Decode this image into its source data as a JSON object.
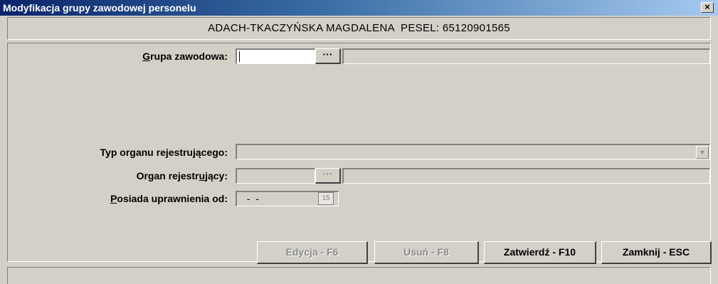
{
  "window": {
    "title": "Modyfikacja grupy zawodowej personelu",
    "close_label": "×"
  },
  "header": {
    "person": "ADACH-TKACZYŃSKA MAGDALENA  PESEL: 65120901565"
  },
  "form": {
    "grupa_zawodowa": {
      "label_accel": "G",
      "label_rest": "rupa zawodowa:",
      "value": "",
      "browse_label": "···",
      "description": ""
    },
    "typ_organu": {
      "label": "Typ organu rejestrującego:",
      "value": "",
      "dropdown_icon": "chevron-down-icon"
    },
    "organ_rejestrujacy": {
      "label_pre": "Organ rejestr",
      "label_accel": "u",
      "label_post": "jący:",
      "value": "",
      "browse_label": "···",
      "description": ""
    },
    "posiada_uprawnienia": {
      "label_accel": "P",
      "label_rest": "osiada uprawnienia od:",
      "value": "  -  -",
      "calendar_label": "15"
    }
  },
  "buttons": {
    "edycja": "Edycja - F6",
    "usun": "Usuń - F8",
    "zatwierdz": "Zatwierdź - F10",
    "zamknij": "Zamknij - ESC"
  },
  "status": {
    "text": ""
  },
  "colors": {
    "title_bar_start": "#0a246a",
    "title_bar_end": "#a6caf0",
    "window_bg": "#d4d0c8",
    "disabled_text": "#8a8a8a"
  }
}
